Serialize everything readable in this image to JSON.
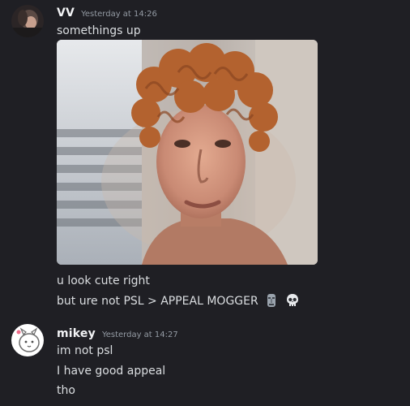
{
  "messages": [
    {
      "username": "VV",
      "timestamp": "Yesterday at 14:26",
      "lines": {
        "l0": "somethings up",
        "l1": "u look cute right",
        "l2": "but ure not PSL > APPEAL MOGGER"
      },
      "emojis": [
        "moai-emoji",
        "skull-emoji"
      ],
      "colors": {
        "username": "#f2f3f5"
      }
    },
    {
      "username": "mikey",
      "timestamp": "Yesterday at 14:27",
      "lines": {
        "l0": "im not psl",
        "l1": "I have good appeal",
        "l2": "tho"
      },
      "colors": {
        "username": "#f2f3f5"
      }
    }
  ],
  "theme": {
    "background": "#1f1f24",
    "text": "#dbdee1",
    "muted": "#949ba4"
  }
}
